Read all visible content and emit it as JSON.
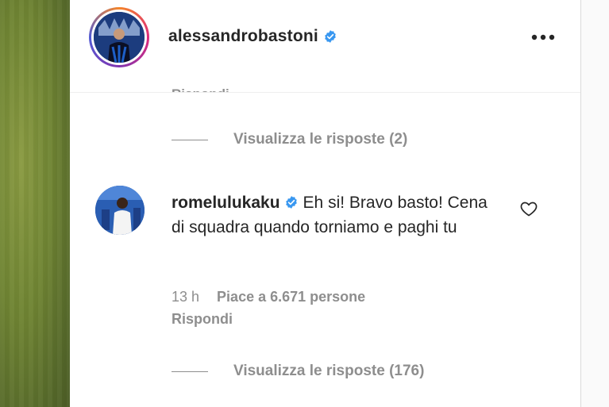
{
  "post": {
    "author": {
      "username": "alessandrobastoni",
      "verified": true
    },
    "options_icon": "more-horizontal-icon"
  },
  "thread": {
    "previous_comment_cutoff_text": "Rispondi",
    "first_replies_label": "Visualizza le risposte (2)",
    "comment": {
      "username": "romelulukaku",
      "verified": true,
      "text": "Eh si! Bravo basto! Cena di squadra quando torniamo e paghi tu",
      "time": "13 h",
      "likes": "Piace a 6.671 persone",
      "reply_label": "Rispondi",
      "like_icon": "heart-outline-icon"
    },
    "second_replies_label": "Visualizza le risposte (176)"
  },
  "colors": {
    "text_primary": "#262626",
    "text_secondary": "#8e8e8e",
    "verified_blue": "#3897f0",
    "divider": "#efefef"
  }
}
